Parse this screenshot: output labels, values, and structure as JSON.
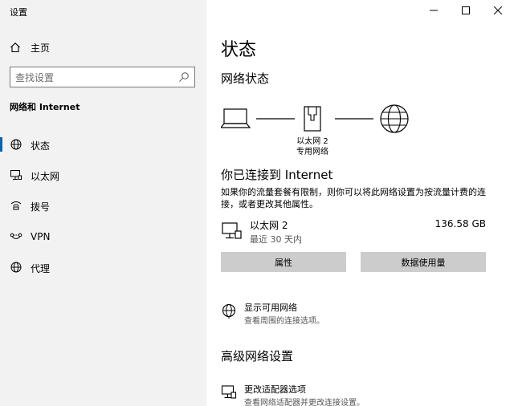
{
  "window": {
    "title": "设置"
  },
  "sidebar": {
    "home_label": "主页",
    "search_placeholder": "查找设置",
    "section_label": "网络和 Internet",
    "items": [
      {
        "label": "状态",
        "icon": "globe-status-icon",
        "active": true
      },
      {
        "label": "以太网",
        "icon": "ethernet-icon",
        "active": false
      },
      {
        "label": "拨号",
        "icon": "dialup-icon",
        "active": false
      },
      {
        "label": "VPN",
        "icon": "vpn-icon",
        "active": false
      },
      {
        "label": "代理",
        "icon": "proxy-globe-icon",
        "active": false
      }
    ]
  },
  "main": {
    "page_title": "状态",
    "network_status_title": "网络状态",
    "diagram": {
      "adapter_name": "以太网 2",
      "adapter_type": "专用网络"
    },
    "connected_title": "你已连接到 Internet",
    "description": "如果你的流量套餐有限制，则你可以将此网络设置为按流量计费的连接，或者更改其他属性。",
    "network": {
      "name": "以太网 2",
      "time": "最近 30 天内",
      "usage": "136.58 GB"
    },
    "buttons": {
      "properties": "属性",
      "data_usage": "数据使用量"
    },
    "show_networks": {
      "title": "显示可用网络",
      "subtitle": "查看周围的连接选项。"
    },
    "advanced_title": "高级网络设置",
    "adapter_options": {
      "title": "更改适配器选项",
      "subtitle": "查看网络适配器并更改连接设置。"
    }
  }
}
